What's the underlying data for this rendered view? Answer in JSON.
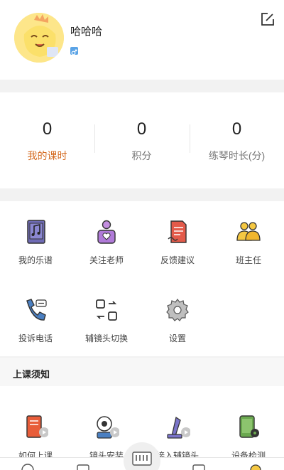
{
  "profile": {
    "username": "哈哈哈",
    "gender": "male"
  },
  "stats": [
    {
      "value": "0",
      "label": "我的课时"
    },
    {
      "value": "0",
      "label": "积分"
    },
    {
      "value": "0",
      "label": "练琴时长(分)"
    }
  ],
  "menu": [
    {
      "label": "我的乐谱",
      "icon": "sheet-music-icon"
    },
    {
      "label": "关注老师",
      "icon": "teacher-icon"
    },
    {
      "label": "反馈建议",
      "icon": "feedback-icon"
    },
    {
      "label": "班主任",
      "icon": "group-icon"
    },
    {
      "label": "投诉电话",
      "icon": "phone-icon"
    },
    {
      "label": "辅镜头切换",
      "icon": "camera-switch-icon"
    },
    {
      "label": "设置",
      "icon": "gear-icon"
    }
  ],
  "notice": {
    "title": "上课须知",
    "items": [
      {
        "label": "如何上课",
        "icon": "book-video-icon"
      },
      {
        "label": "镜头安装",
        "icon": "camera-video-icon"
      },
      {
        "label": "接入辅镜头",
        "icon": "lamp-video-icon"
      },
      {
        "label": "设备检测",
        "icon": "device-check-icon"
      }
    ]
  },
  "colors": {
    "accent": "#d4691e",
    "background": "#f2f2f2"
  }
}
